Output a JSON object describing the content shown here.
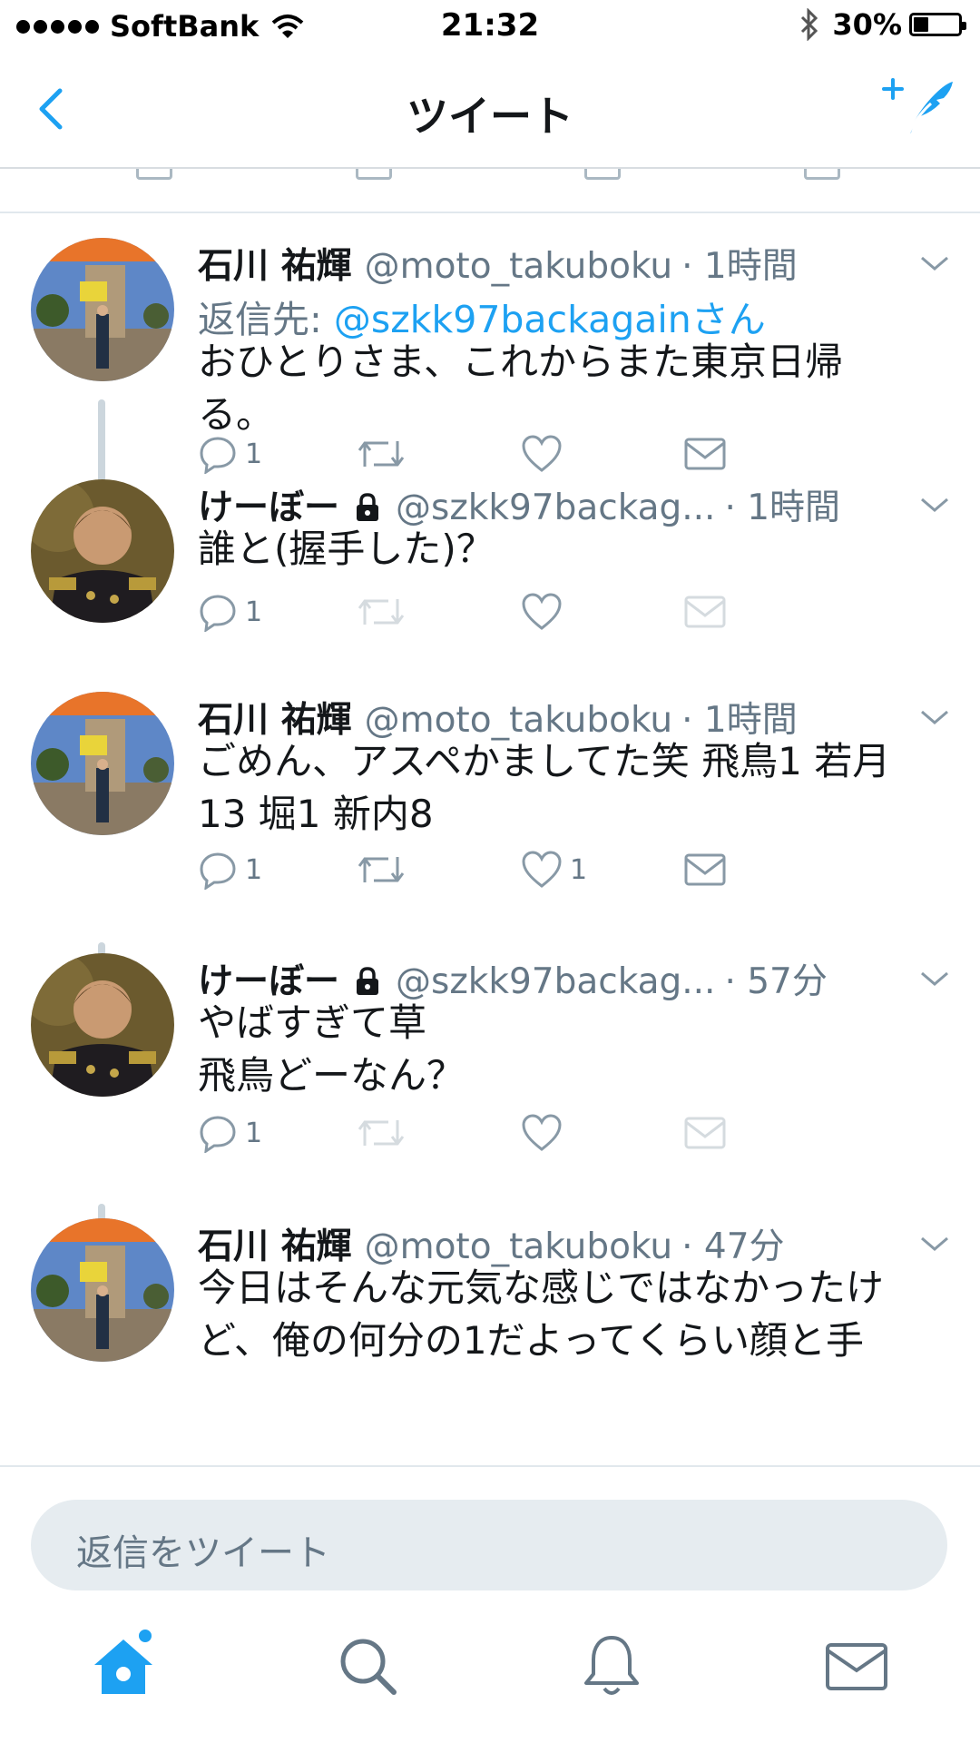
{
  "status_bar": {
    "carrier": "SoftBank",
    "time": "21:32",
    "battery": "30%"
  },
  "nav": {
    "title": "ツイート"
  },
  "tweets": [
    {
      "name": "石川 祐輝",
      "handle": "@moto_takuboku",
      "time": "· 1時間",
      "protected": false,
      "reply_prefix": "返信先: ",
      "reply_to": "@szkk97backagainさん",
      "lines": [
        "おひとりさま、これからまた東京日帰",
        "る。"
      ],
      "reply_count": "1",
      "retweet_count": "",
      "like_count": "",
      "retweet_enabled": true,
      "dm_enabled": true
    },
    {
      "name": "けーぼー",
      "handle": "@szkk97backag...",
      "time": "· 1時間",
      "protected": true,
      "lines": [
        "誰と(握手した)？"
      ],
      "reply_count": "1",
      "retweet_count": "",
      "like_count": "",
      "retweet_enabled": false,
      "dm_enabled": false
    },
    {
      "name": "石川 祐輝",
      "handle": "@moto_takuboku",
      "time": "· 1時間",
      "protected": false,
      "lines": [
        "ごめん、アスペかましてた笑 飛鳥1 若月",
        "13 堀1 新内8"
      ],
      "reply_count": "1",
      "retweet_count": "",
      "like_count": "1",
      "retweet_enabled": true,
      "dm_enabled": true
    },
    {
      "name": "けーぼー",
      "handle": "@szkk97backag...",
      "time": "· 57分",
      "protected": true,
      "lines": [
        "やばすぎて草",
        "飛鳥どーなん？"
      ],
      "reply_count": "1",
      "retweet_count": "",
      "like_count": "",
      "retweet_enabled": false,
      "dm_enabled": false
    },
    {
      "name": "石川 祐輝",
      "handle": "@moto_takuboku",
      "time": "· 47分",
      "protected": false,
      "lines": [
        "今日はそんな元気な感じではなかったけ",
        "ど、俺の何分の1だよってくらい顔と手"
      ],
      "reply_count": "",
      "retweet_count": "",
      "like_count": "",
      "retweet_enabled": true,
      "dm_enabled": true
    }
  ],
  "reply_bar": {
    "placeholder": "返信をツイート"
  },
  "colors": {
    "accent": "#1da1f2",
    "secondary_text": "#657786",
    "thread_line": "#ccd6dd",
    "reply_bar_bg": "#e6ecf0"
  },
  "icons": {
    "back": "chevron-left-icon",
    "compose": "compose-tweet-icon",
    "reply": "reply-bubble-icon",
    "retweet": "retweet-icon",
    "like": "heart-icon",
    "dm": "envelope-icon",
    "lock": "lock-icon",
    "tab_home": "home-icon",
    "tab_search": "search-icon",
    "tab_notifications": "bell-icon",
    "tab_messages": "envelope-icon"
  }
}
